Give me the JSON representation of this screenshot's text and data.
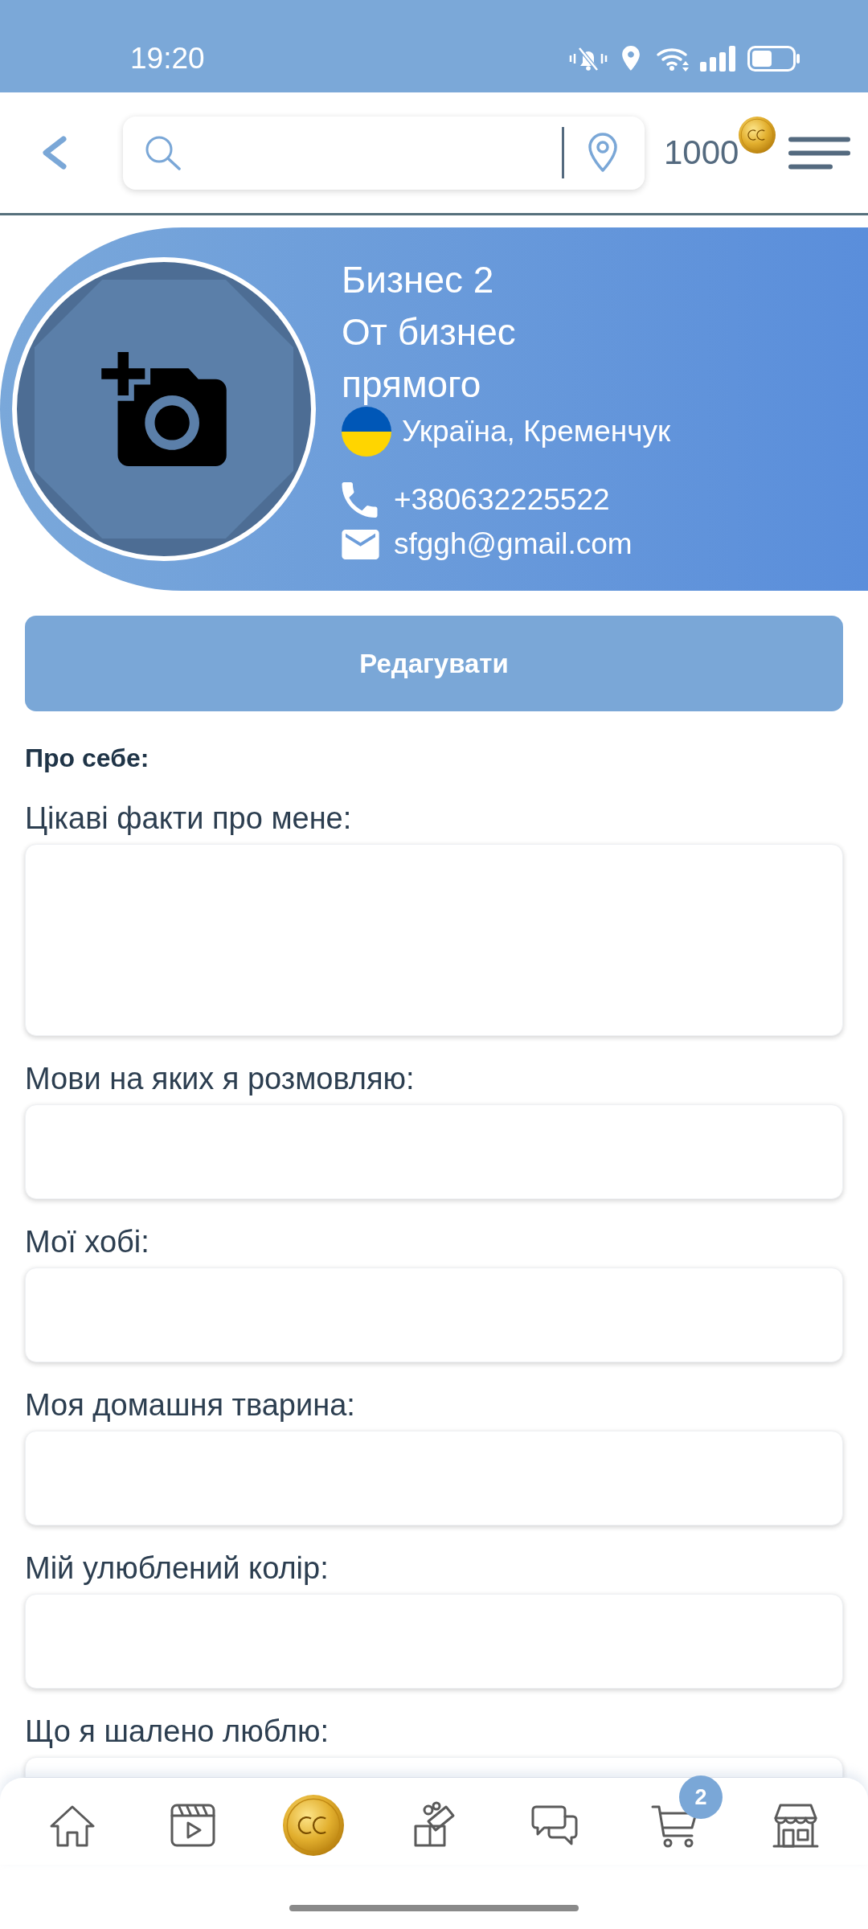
{
  "status_bar": {
    "time": "19:20"
  },
  "header": {
    "coin_balance": "1000"
  },
  "profile": {
    "name": "Бизнес 2",
    "description": "От бизнес прямого",
    "location": "Україна, Кременчук",
    "phone": "+380632225522",
    "email": "sfggh@gmail.com"
  },
  "edit_button": "Редагувати",
  "about": {
    "heading": "Про себе:",
    "fields": [
      {
        "label": "Цікаві факти про мене:",
        "kind": "multiline"
      },
      {
        "label": "Мови на яких я розмовляю:",
        "kind": "line"
      },
      {
        "label": "Мої хобі:",
        "kind": "line"
      },
      {
        "label": "Моя домашня тварина:",
        "kind": "line"
      },
      {
        "label": "Мій улюблений колір:",
        "kind": "line"
      },
      {
        "label": "Що я шалено люблю:",
        "kind": "line"
      }
    ]
  },
  "bottom_nav": {
    "items": [
      {
        "kind": "home"
      },
      {
        "kind": "video"
      },
      {
        "kind": "coins"
      },
      {
        "kind": "gifts"
      },
      {
        "kind": "chat"
      },
      {
        "kind": "cart",
        "badge": "2"
      },
      {
        "kind": "shop"
      }
    ]
  }
}
